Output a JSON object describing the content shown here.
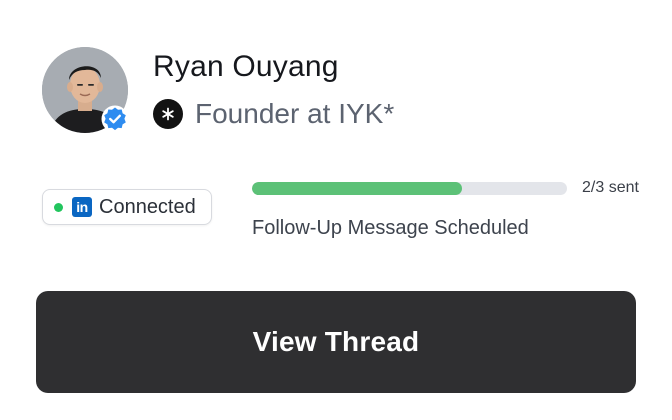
{
  "profile": {
    "name": "Ryan Ouyang",
    "role": "Founder at IYK*",
    "avatar_icon": "person-photo",
    "verified_icon": "verified-badge-icon",
    "company_logo_glyph": "*"
  },
  "connection": {
    "status_label": "Connected",
    "network_icon": "linkedin-icon",
    "network_icon_text": "in",
    "status_color": "#22c55e"
  },
  "progress": {
    "sent_label": "2/3 sent",
    "fraction": 0.6667,
    "status_text": "Follow-Up Message Scheduled",
    "fill_color": "#5cc177"
  },
  "actions": {
    "view_thread_label": "View Thread"
  }
}
